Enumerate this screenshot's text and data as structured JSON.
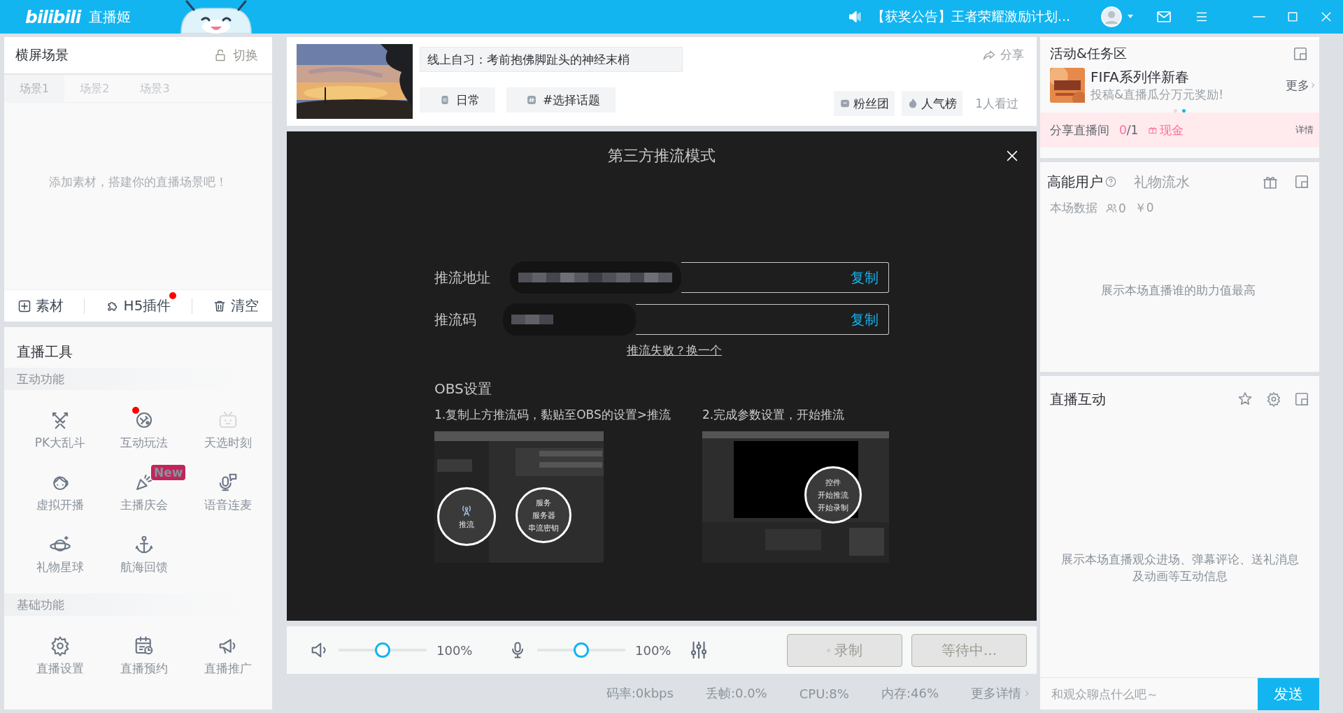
{
  "topbar": {
    "logo": "bilibili",
    "app_name": "直播姬",
    "notice": "【获奖公告】王者荣耀激励计划..."
  },
  "scene_panel": {
    "title": "横屏场景",
    "switch": "切换",
    "tabs": [
      {
        "label": "场景1",
        "selected": true
      },
      {
        "label": "场景2",
        "selected": false
      },
      {
        "label": "场景3",
        "selected": false
      }
    ],
    "empty_hint": "添加素材，搭建你的直播场景吧！",
    "actions": [
      {
        "label": "素材",
        "kind": "add",
        "dot": false
      },
      {
        "label": "H5插件",
        "kind": "plugin",
        "dot": true
      },
      {
        "label": "清空",
        "kind": "clear",
        "dot": false
      }
    ]
  },
  "tools": {
    "title": "直播工具",
    "sections": [
      {
        "name": "互动功能",
        "items": [
          {
            "label": "PK大乱斗",
            "kind": "pk",
            "dot": false,
            "disabled": false
          },
          {
            "label": "互动玩法",
            "kind": "play",
            "dot": true,
            "disabled": false
          },
          {
            "label": "天选时刻",
            "kind": "tv",
            "dot": false,
            "disabled": true
          },
          {
            "label": "虚拟开播",
            "kind": "avatar",
            "dot": false,
            "disabled": false
          },
          {
            "label": "主播庆会",
            "kind": "party",
            "dot": false,
            "disabled": false,
            "badge": "New"
          },
          {
            "label": "语音连麦",
            "kind": "voice",
            "dot": false,
            "disabled": false
          },
          {
            "label": "礼物星球",
            "kind": "planet",
            "dot": false,
            "disabled": false
          },
          {
            "label": "航海回馈",
            "kind": "anchor",
            "dot": false,
            "disabled": false
          }
        ]
      },
      {
        "name": "基础功能",
        "items": [
          {
            "label": "直播设置",
            "kind": "settings",
            "dot": false,
            "disabled": false
          },
          {
            "label": "直播预约",
            "kind": "calendar",
            "dot": false,
            "disabled": false
          },
          {
            "label": "直播推广",
            "kind": "promote",
            "dot": false,
            "disabled": false
          }
        ]
      }
    ]
  },
  "stream_card": {
    "title": "线上自习：考前抱佛脚趾头的神经末梢",
    "share": "分享",
    "tags": [
      {
        "label": "日常",
        "kind": "area"
      },
      {
        "label": "#选择话题",
        "kind": "topic"
      }
    ],
    "stats": [
      {
        "label": "粉丝团",
        "kind": "fans"
      },
      {
        "label": "人气榜",
        "kind": "hot"
      },
      {
        "label": "1人看过",
        "kind": "plain"
      }
    ]
  },
  "dialog": {
    "title": "第三方推流模式",
    "fields": [
      {
        "label": "推流地址",
        "action": "复制"
      },
      {
        "label": "推流码",
        "action": "复制"
      }
    ],
    "link": "推流失败？换一个",
    "obs_title": "OBS设置",
    "steps": [
      {
        "text": "1.复制上方推流码，黏贴至OBS的设置>推流",
        "callouts": [
          {
            "lines": [
              "推流"
            ],
            "kind": "antenna"
          },
          {
            "lines": [
              "服务",
              "服务器",
              "串流密钥"
            ],
            "kind": "form"
          }
        ]
      },
      {
        "text": "2.完成参数设置，开始推流",
        "callouts": [
          {
            "lines": [
              "控件",
              "开始推流",
              "开始录制"
            ],
            "kind": "menu"
          }
        ]
      }
    ]
  },
  "controls": {
    "sliders": [
      {
        "kind": "speaker",
        "level": 0.5,
        "reading": "100%"
      },
      {
        "kind": "mic",
        "level": 0.5,
        "reading": "100%"
      }
    ],
    "buttons": [
      {
        "label": "录制",
        "kind": "record",
        "disabled": true
      },
      {
        "label": "等待中...",
        "kind": "start",
        "disabled": true
      }
    ]
  },
  "status_bar": {
    "items": [
      "码率:0kbps",
      "丢帧:0.0%",
      "CPU:8%",
      "内存:46%"
    ],
    "more": "更多详情"
  },
  "activity": {
    "title": "活动&任务区",
    "promo_title": "FIFA系列伴新春",
    "promo_subtitle": "投稿&直播瓜分万元奖励!",
    "more": "更多",
    "dots": [
      {
        "selected": false
      },
      {
        "selected": true
      }
    ],
    "share_label": "分享直播间",
    "share_progress_done": "0",
    "share_progress_total": "/1",
    "reward": "现金",
    "detail": "详情"
  },
  "energy": {
    "tabs": [
      {
        "label": "高能用户",
        "selected": true
      },
      {
        "label": "礼物流水",
        "selected": false
      }
    ],
    "stats_label": "本场数据",
    "viewers": "0",
    "income": "￥0",
    "hint": "展示本场直播谁的助力值最高"
  },
  "interact": {
    "title": "直播互动",
    "hint_lines": [
      "展示本场直播观众进场、弹幕评论、送礼消息",
      "及动画等互动信息"
    ],
    "chat_placeholder": "和观众聊点什么吧～",
    "send": "发送"
  }
}
